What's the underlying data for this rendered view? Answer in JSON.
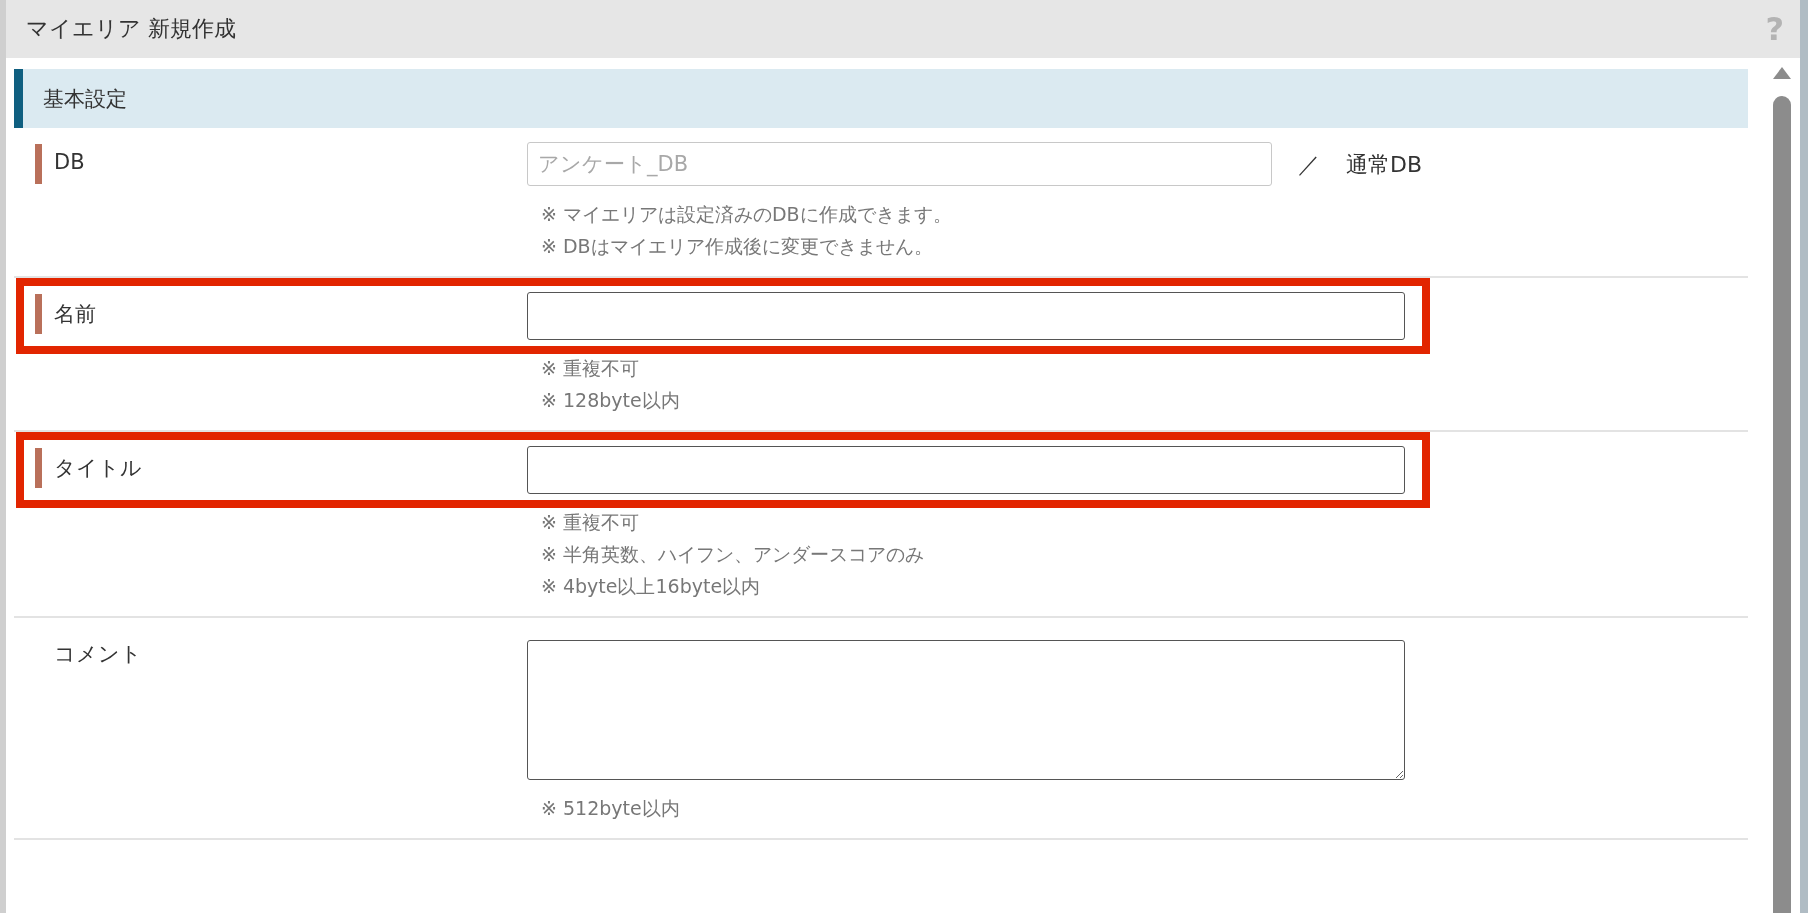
{
  "dialog": {
    "title": "マイエリア 新規作成",
    "help": "?"
  },
  "section": {
    "title": "基本設定"
  },
  "fields": [
    {
      "kind": "text",
      "label": "DB",
      "required": true,
      "highlighted": false,
      "disabled": true,
      "value": "アンケート_DB",
      "separator": "／",
      "suffix": "通常DB",
      "notes": [
        "※ マイエリアは設定済みのDBに作成できます。",
        "※ DBはマイエリア作成後に変更できません。"
      ]
    },
    {
      "kind": "text",
      "label": "名前",
      "required": true,
      "highlighted": true,
      "disabled": false,
      "notes": [
        "※ 重複不可",
        "※ 128byte以内"
      ]
    },
    {
      "kind": "text",
      "label": "タイトル",
      "required": true,
      "highlighted": true,
      "disabled": false,
      "notes": [
        "※ 重複不可",
        "※ 半角英数、ハイフン、アンダースコアのみ",
        "※ 4byte以上16byte以内"
      ]
    },
    {
      "kind": "textarea",
      "label": "コメント",
      "required": false,
      "highlighted": false,
      "disabled": false,
      "notes": [
        "※ 512byte以内"
      ]
    }
  ]
}
